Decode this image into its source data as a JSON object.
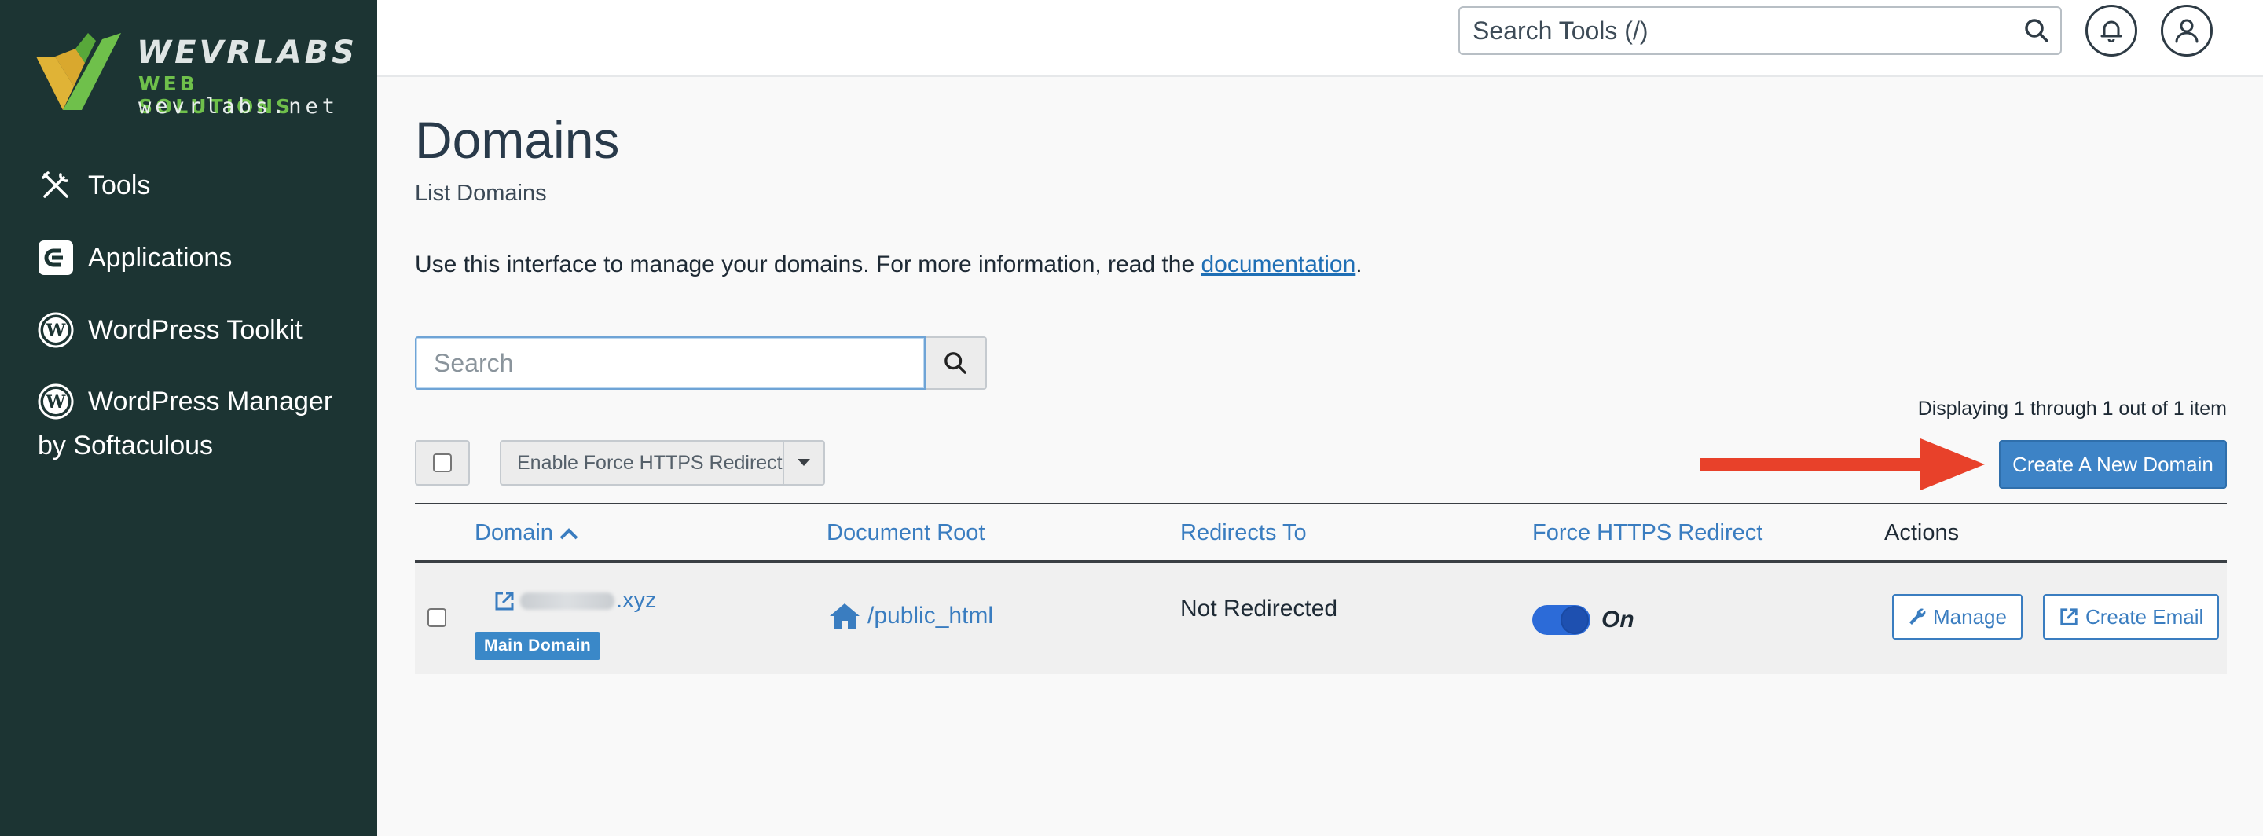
{
  "brand": {
    "line1": "WEVRLABS",
    "line2": "WEB SOLUTIONS",
    "line3": "wevrlabs.net",
    "colors": {
      "sidebar_bg": "#1c3433",
      "logo_yellow": "#e0b336",
      "logo_green": "#6fc04b"
    }
  },
  "sidebar": {
    "items": [
      {
        "label": "Tools",
        "icon": "tools-icon"
      },
      {
        "label": "Applications",
        "icon": "applications-icon"
      },
      {
        "label": "WordPress Toolkit",
        "icon": "wordpress-icon"
      },
      {
        "label": "WordPress Manager",
        "label2": "by Softaculous",
        "icon": "wordpress-icon"
      }
    ]
  },
  "header": {
    "search_placeholder": "Search Tools (/)",
    "bell_icon": "bell-icon",
    "user_icon": "user-icon"
  },
  "page": {
    "title": "Domains",
    "subtitle": "List Domains",
    "intro_text": "Use this interface to manage your domains. For more information, read the ",
    "intro_link": "documentation",
    "intro_end": "."
  },
  "search": {
    "placeholder": "Search"
  },
  "display_count": "Displaying 1 through 1 out of 1 item",
  "bulk": {
    "action_label": "Enable Force HTTPS Redirect"
  },
  "create_button": "Create A New Domain",
  "accent_color": "#3d83c6",
  "arrow_color": "#e8412a",
  "table": {
    "headers": {
      "domain": "Domain",
      "document_root": "Document Root",
      "redirects_to": "Redirects To",
      "force_https": "Force HTTPS Redirect",
      "actions": "Actions"
    },
    "rows": [
      {
        "domain_suffix": ".xyz",
        "badge": "Main Domain",
        "document_root": "/public_html",
        "redirects_to": "Not Redirected",
        "force_https": "On",
        "manage": "Manage",
        "create_email": "Create Email"
      }
    ]
  }
}
